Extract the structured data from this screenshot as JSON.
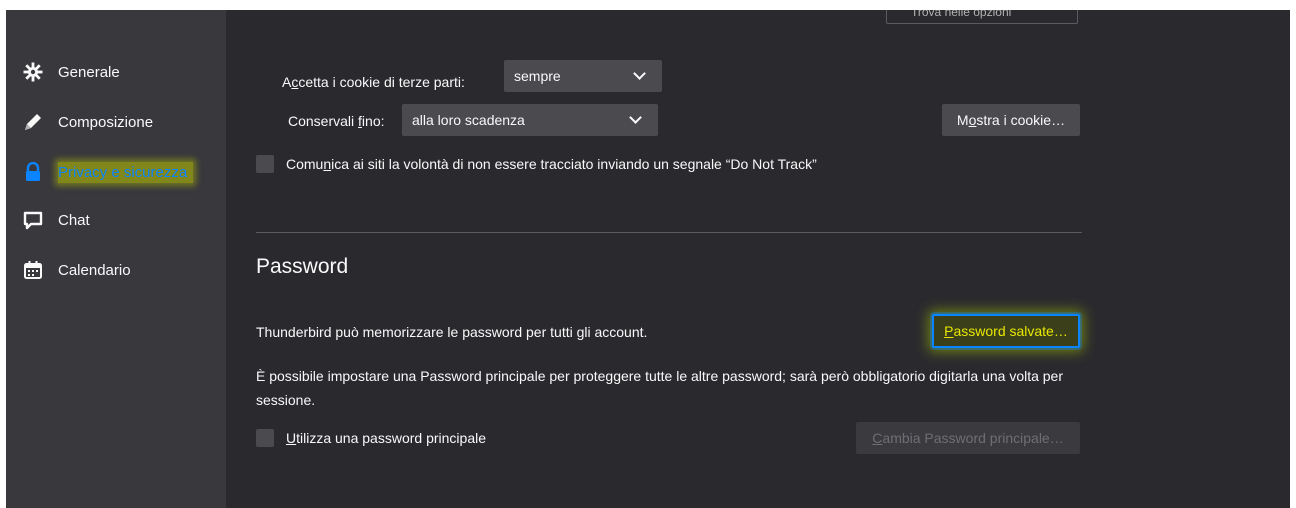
{
  "search": {
    "placeholder": "Trova nelle opzioni"
  },
  "sidebar": {
    "items": [
      {
        "label": "Generale",
        "icon": "gear-icon"
      },
      {
        "label": "Composizione",
        "icon": "pencil-icon"
      },
      {
        "label": "Privacy e sicurezza",
        "icon": "lock-icon",
        "active": true
      },
      {
        "label": "Chat",
        "icon": "chat-icon"
      },
      {
        "label": "Calendario",
        "icon": "calendar-icon"
      }
    ]
  },
  "cookies": {
    "third_party_label_a": "A",
    "third_party_label_u": "c",
    "third_party_label_b": "cetta i cookie di terze parti:",
    "third_party_value": "sempre",
    "keep_label_a": "Conservali ",
    "keep_label_u": "f",
    "keep_label_b": "ino:",
    "keep_value": "alla loro scadenza",
    "show_cookies_a": "M",
    "show_cookies_u": "o",
    "show_cookies_b": "stra i cookie…",
    "dnt_a": "Comu",
    "dnt_u": "n",
    "dnt_b": "ica ai siti la volontà di non essere tracciato inviando un segnale “Do Not Track”"
  },
  "password": {
    "heading": "Password",
    "save_text": "Thunderbird può memorizzare le password per tutti gli account.",
    "saved_button_u": "P",
    "saved_button_b": "assword salvate…",
    "primary_desc": "È possibile impostare una Password principale per proteggere tutte le altre password; sarà però obbligatorio digitarla una volta per sessione.",
    "use_primary_u": "U",
    "use_primary_b": "tilizza una password principale",
    "change_primary_u": "C",
    "change_primary_b": "ambia Password principale…"
  },
  "colors": {
    "accent": "#0a84ff",
    "highlight": "#c8d400",
    "bg": "#2a2a2e",
    "sidebar": "#38383d"
  }
}
